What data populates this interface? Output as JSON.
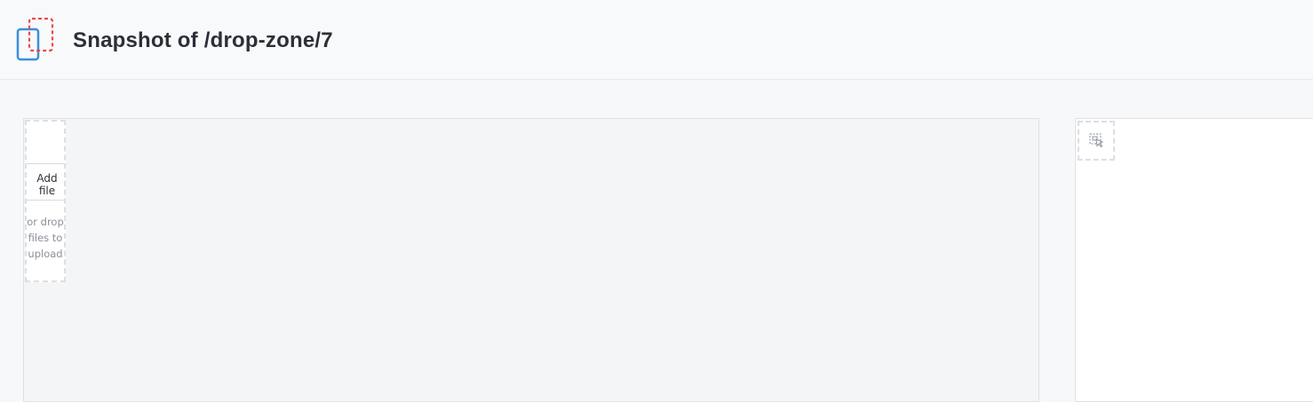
{
  "header": {
    "title": "Snapshot of /drop-zone/7",
    "logo_icon": "snapshot-logo-icon"
  },
  "drop_zone": {
    "add_file_label": "Add file",
    "hint": "or drop files to upload"
  },
  "side_panel": {
    "tool_icon": "selection-cursor-icon"
  },
  "colors": {
    "logo_blue": "#3b8fd9",
    "logo_red": "#e94b4b",
    "title": "#2b2f36",
    "hint": "#8b9099"
  }
}
